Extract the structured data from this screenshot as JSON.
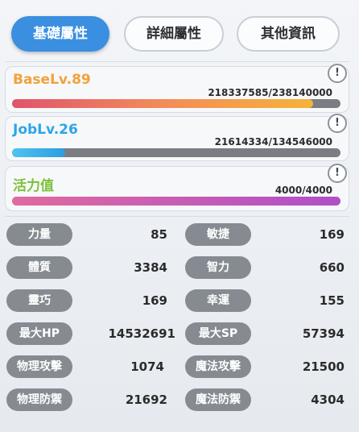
{
  "tabs": [
    {
      "label": "基礎屬性",
      "active": true
    },
    {
      "label": "詳細屬性",
      "active": false
    },
    {
      "label": "其他資訊",
      "active": false
    }
  ],
  "base": {
    "label": "BaseLv.89",
    "value": "218337585/238140000",
    "progress": 0.917,
    "color": "#f0a23a"
  },
  "job": {
    "label": "JobLv.26",
    "value": "21614334/134546000",
    "progress": 0.161,
    "color": "#2aa6e8"
  },
  "vitality": {
    "label": "活力值",
    "value": "4000/4000",
    "progress": 1.0,
    "color": "#b04fc8"
  },
  "info_glyph": "!",
  "stats_left": [
    {
      "label": "力量",
      "value": "85"
    },
    {
      "label": "體質",
      "value": "3384"
    },
    {
      "label": "靈巧",
      "value": "169"
    },
    {
      "label": "最大HP",
      "value": "14532691"
    },
    {
      "label": "物理攻擊",
      "value": "1074"
    },
    {
      "label": "物理防禦",
      "value": "21692"
    }
  ],
  "stats_right": [
    {
      "label": "敏捷",
      "value": "169"
    },
    {
      "label": "智力",
      "value": "660"
    },
    {
      "label": "幸運",
      "value": "155"
    },
    {
      "label": "最大SP",
      "value": "57394"
    },
    {
      "label": "魔法攻擊",
      "value": "21500"
    },
    {
      "label": "魔法防禦",
      "value": "4304"
    }
  ]
}
